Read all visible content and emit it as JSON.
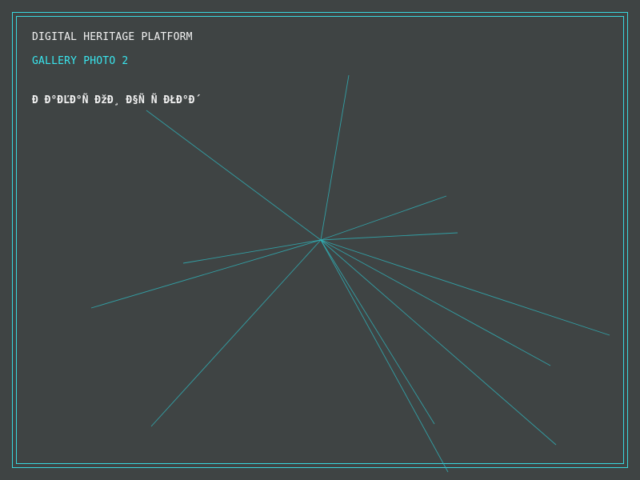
{
  "header": {
    "platform_title": "DIGITAL HERITAGE PLATFORM",
    "gallery_label": "GALLERY PHOTO 2",
    "corrupted_caption": "Ð Ð°ÐĽÐ°Ñ ÐžÐ¸ Ð§Ñ Ñ ÐŁÐ°Ð´"
  },
  "colors": {
    "background": "#3f4444",
    "accent": "#39d8df",
    "text": "#f2f2f2"
  }
}
